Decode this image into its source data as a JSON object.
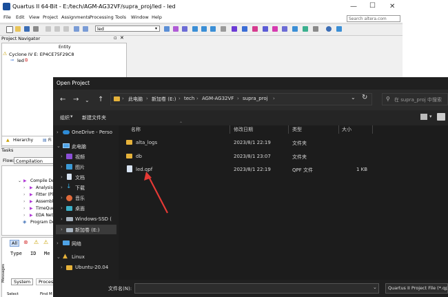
{
  "quartus": {
    "title": "Quartus II 64-Bit - E:/tech/AGM-AG32VF/supra_proj/led - led",
    "menu": [
      "File",
      "Edit",
      "View",
      "Project",
      "Assignments",
      "Processing",
      "Tools",
      "Window",
      "Help"
    ],
    "search_placeholder": "Search altera.com",
    "entity_value": "led",
    "navigator_title": "Project Navigator",
    "entity_header": "Entity",
    "device": "Cyclone IV E: EP4CE75F29C8",
    "top_entity": "led",
    "hierarchy_tab": "Hierarchy",
    "files_tab": "Fi",
    "tasks_title": "Tasks",
    "flow_label": "Flow:",
    "flow_value": "Compilation",
    "tasks": [
      "Compile Des",
      "Analysis",
      "Fitter (Pl",
      "Assembl",
      "TimeQue",
      "EDA Netl",
      "Program De"
    ],
    "msg_filter_all": "All",
    "msg_cols": [
      "Type",
      "ID",
      "Me"
    ],
    "msg_tabs": [
      "System",
      "Process"
    ],
    "messages_vertical": "Messages",
    "status_left": "Select",
    "status_right": "Find M"
  },
  "dialog": {
    "title": "Open Project",
    "breadcrumb": [
      "此电脑",
      "新加卷 (E:)",
      "tech",
      "AGM-AG32VF",
      "supra_proj"
    ],
    "search_placeholder": "在 supra_proj 中搜索",
    "organize": "组织",
    "new_folder": "新建文件夹",
    "sidebar": [
      {
        "label": "OneDrive - Perso",
        "icon": "cloud-icon"
      },
      {
        "label": "此电脑",
        "icon": "computer-icon"
      },
      {
        "label": "视频",
        "icon": "video-icon"
      },
      {
        "label": "图片",
        "icon": "picture-icon"
      },
      {
        "label": "文档",
        "icon": "document-icon"
      },
      {
        "label": "下载",
        "icon": "download-icon"
      },
      {
        "label": "音乐",
        "icon": "music-icon"
      },
      {
        "label": "桌面",
        "icon": "desktop-icon"
      },
      {
        "label": "Windows-SSD (",
        "icon": "drive-icon"
      },
      {
        "label": "新加卷 (E:)",
        "icon": "drive-icon"
      },
      {
        "label": "网络",
        "icon": "network-icon"
      },
      {
        "label": "Linux",
        "icon": "linux-icon"
      },
      {
        "label": "Ubuntu-20.04",
        "icon": "folder-icon"
      }
    ],
    "columns": {
      "name": "名称",
      "date": "修改日期",
      "type": "类型",
      "size": "大小"
    },
    "files": [
      {
        "name": "alta_logs",
        "date": "2023/8/1 22:19",
        "type": "文件夹",
        "size": ""
      },
      {
        "name": "db",
        "date": "2023/8/1 23:07",
        "type": "文件夹",
        "size": ""
      },
      {
        "name": "led.qpf",
        "date": "2023/8/1 22:19",
        "type": "QPF 文件",
        "size": "1 KB"
      }
    ],
    "filename_label": "文件名(N):",
    "filetype_value": "Quartus II Project File (*.qpf)",
    "accent_color": "#e53935"
  }
}
